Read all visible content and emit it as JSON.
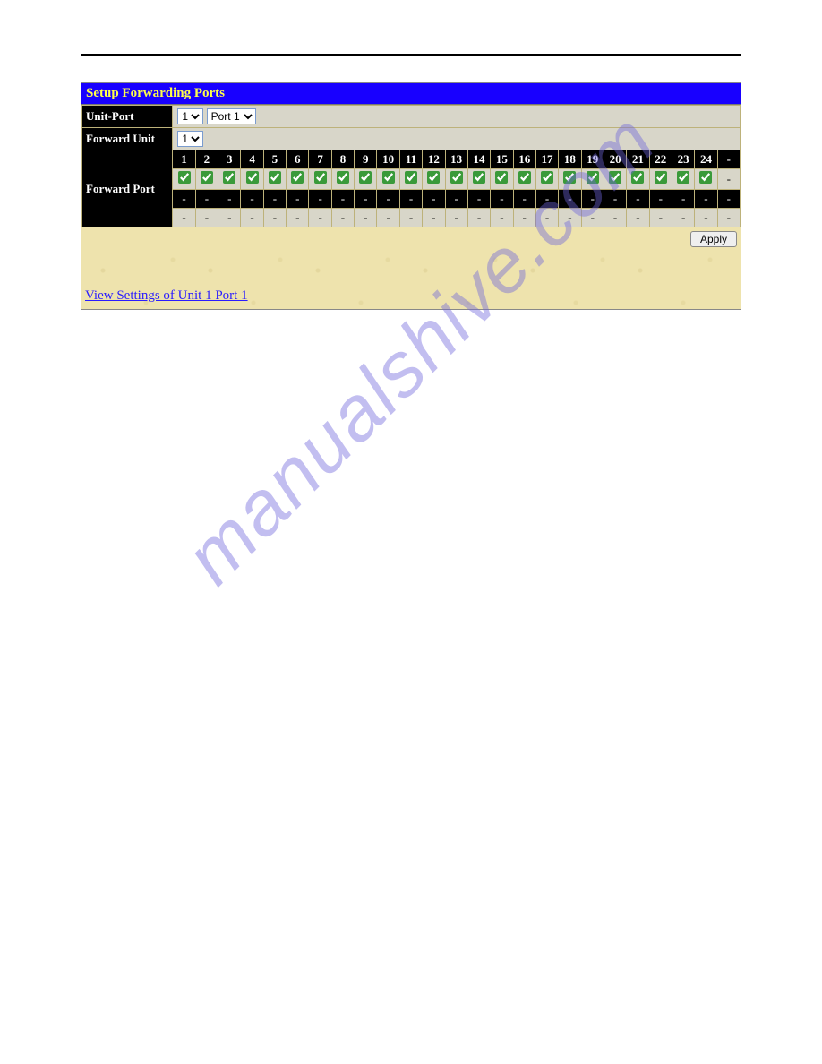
{
  "watermark": "manualshive.com",
  "panel": {
    "title": "Setup Forwarding Ports",
    "unit_port_label": "Unit-Port",
    "forward_unit_label": "Forward Unit",
    "forward_port_label": "Forward Port",
    "unit_select": "1",
    "port_select": "Port 1",
    "forward_unit_select": "1",
    "headers": [
      "1",
      "2",
      "3",
      "4",
      "5",
      "6",
      "7",
      "8",
      "9",
      "10",
      "11",
      "12",
      "13",
      "14",
      "15",
      "16",
      "17",
      "18",
      "19",
      "20",
      "21",
      "22",
      "23",
      "24",
      "-"
    ],
    "checks": [
      true,
      true,
      true,
      true,
      true,
      true,
      true,
      true,
      true,
      true,
      true,
      true,
      true,
      true,
      true,
      true,
      true,
      true,
      true,
      true,
      true,
      true,
      true,
      true,
      null
    ],
    "dash": "-",
    "apply_label": "Apply",
    "view_link": "View Settings of Unit 1 Port 1"
  }
}
